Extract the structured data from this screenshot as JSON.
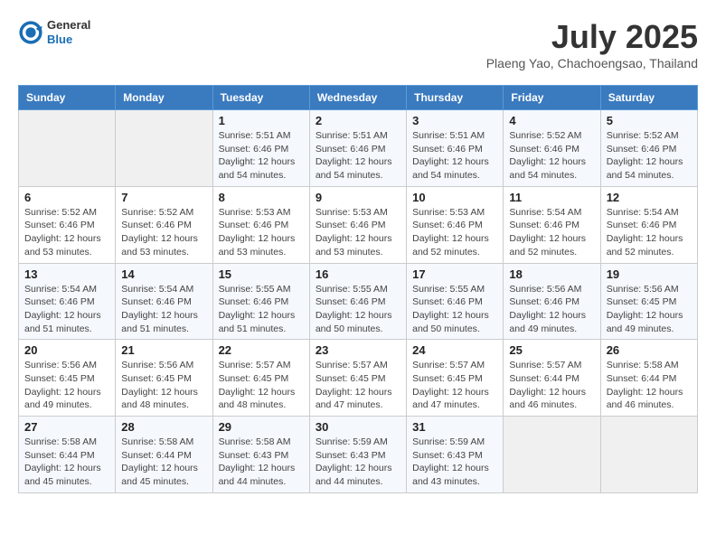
{
  "logo": {
    "general": "General",
    "blue": "Blue"
  },
  "title": "July 2025",
  "subtitle": "Plaeng Yao, Chachoengsao, Thailand",
  "days_of_week": [
    "Sunday",
    "Monday",
    "Tuesday",
    "Wednesday",
    "Thursday",
    "Friday",
    "Saturday"
  ],
  "weeks": [
    [
      {
        "day": "",
        "sunrise": "",
        "sunset": "",
        "daylight": ""
      },
      {
        "day": "",
        "sunrise": "",
        "sunset": "",
        "daylight": ""
      },
      {
        "day": "1",
        "sunrise": "Sunrise: 5:51 AM",
        "sunset": "Sunset: 6:46 PM",
        "daylight": "Daylight: 12 hours and 54 minutes."
      },
      {
        "day": "2",
        "sunrise": "Sunrise: 5:51 AM",
        "sunset": "Sunset: 6:46 PM",
        "daylight": "Daylight: 12 hours and 54 minutes."
      },
      {
        "day": "3",
        "sunrise": "Sunrise: 5:51 AM",
        "sunset": "Sunset: 6:46 PM",
        "daylight": "Daylight: 12 hours and 54 minutes."
      },
      {
        "day": "4",
        "sunrise": "Sunrise: 5:52 AM",
        "sunset": "Sunset: 6:46 PM",
        "daylight": "Daylight: 12 hours and 54 minutes."
      },
      {
        "day": "5",
        "sunrise": "Sunrise: 5:52 AM",
        "sunset": "Sunset: 6:46 PM",
        "daylight": "Daylight: 12 hours and 54 minutes."
      }
    ],
    [
      {
        "day": "6",
        "sunrise": "Sunrise: 5:52 AM",
        "sunset": "Sunset: 6:46 PM",
        "daylight": "Daylight: 12 hours and 53 minutes."
      },
      {
        "day": "7",
        "sunrise": "Sunrise: 5:52 AM",
        "sunset": "Sunset: 6:46 PM",
        "daylight": "Daylight: 12 hours and 53 minutes."
      },
      {
        "day": "8",
        "sunrise": "Sunrise: 5:53 AM",
        "sunset": "Sunset: 6:46 PM",
        "daylight": "Daylight: 12 hours and 53 minutes."
      },
      {
        "day": "9",
        "sunrise": "Sunrise: 5:53 AM",
        "sunset": "Sunset: 6:46 PM",
        "daylight": "Daylight: 12 hours and 53 minutes."
      },
      {
        "day": "10",
        "sunrise": "Sunrise: 5:53 AM",
        "sunset": "Sunset: 6:46 PM",
        "daylight": "Daylight: 12 hours and 52 minutes."
      },
      {
        "day": "11",
        "sunrise": "Sunrise: 5:54 AM",
        "sunset": "Sunset: 6:46 PM",
        "daylight": "Daylight: 12 hours and 52 minutes."
      },
      {
        "day": "12",
        "sunrise": "Sunrise: 5:54 AM",
        "sunset": "Sunset: 6:46 PM",
        "daylight": "Daylight: 12 hours and 52 minutes."
      }
    ],
    [
      {
        "day": "13",
        "sunrise": "Sunrise: 5:54 AM",
        "sunset": "Sunset: 6:46 PM",
        "daylight": "Daylight: 12 hours and 51 minutes."
      },
      {
        "day": "14",
        "sunrise": "Sunrise: 5:54 AM",
        "sunset": "Sunset: 6:46 PM",
        "daylight": "Daylight: 12 hours and 51 minutes."
      },
      {
        "day": "15",
        "sunrise": "Sunrise: 5:55 AM",
        "sunset": "Sunset: 6:46 PM",
        "daylight": "Daylight: 12 hours and 51 minutes."
      },
      {
        "day": "16",
        "sunrise": "Sunrise: 5:55 AM",
        "sunset": "Sunset: 6:46 PM",
        "daylight": "Daylight: 12 hours and 50 minutes."
      },
      {
        "day": "17",
        "sunrise": "Sunrise: 5:55 AM",
        "sunset": "Sunset: 6:46 PM",
        "daylight": "Daylight: 12 hours and 50 minutes."
      },
      {
        "day": "18",
        "sunrise": "Sunrise: 5:56 AM",
        "sunset": "Sunset: 6:46 PM",
        "daylight": "Daylight: 12 hours and 49 minutes."
      },
      {
        "day": "19",
        "sunrise": "Sunrise: 5:56 AM",
        "sunset": "Sunset: 6:45 PM",
        "daylight": "Daylight: 12 hours and 49 minutes."
      }
    ],
    [
      {
        "day": "20",
        "sunrise": "Sunrise: 5:56 AM",
        "sunset": "Sunset: 6:45 PM",
        "daylight": "Daylight: 12 hours and 49 minutes."
      },
      {
        "day": "21",
        "sunrise": "Sunrise: 5:56 AM",
        "sunset": "Sunset: 6:45 PM",
        "daylight": "Daylight: 12 hours and 48 minutes."
      },
      {
        "day": "22",
        "sunrise": "Sunrise: 5:57 AM",
        "sunset": "Sunset: 6:45 PM",
        "daylight": "Daylight: 12 hours and 48 minutes."
      },
      {
        "day": "23",
        "sunrise": "Sunrise: 5:57 AM",
        "sunset": "Sunset: 6:45 PM",
        "daylight": "Daylight: 12 hours and 47 minutes."
      },
      {
        "day": "24",
        "sunrise": "Sunrise: 5:57 AM",
        "sunset": "Sunset: 6:45 PM",
        "daylight": "Daylight: 12 hours and 47 minutes."
      },
      {
        "day": "25",
        "sunrise": "Sunrise: 5:57 AM",
        "sunset": "Sunset: 6:44 PM",
        "daylight": "Daylight: 12 hours and 46 minutes."
      },
      {
        "day": "26",
        "sunrise": "Sunrise: 5:58 AM",
        "sunset": "Sunset: 6:44 PM",
        "daylight": "Daylight: 12 hours and 46 minutes."
      }
    ],
    [
      {
        "day": "27",
        "sunrise": "Sunrise: 5:58 AM",
        "sunset": "Sunset: 6:44 PM",
        "daylight": "Daylight: 12 hours and 45 minutes."
      },
      {
        "day": "28",
        "sunrise": "Sunrise: 5:58 AM",
        "sunset": "Sunset: 6:44 PM",
        "daylight": "Daylight: 12 hours and 45 minutes."
      },
      {
        "day": "29",
        "sunrise": "Sunrise: 5:58 AM",
        "sunset": "Sunset: 6:43 PM",
        "daylight": "Daylight: 12 hours and 44 minutes."
      },
      {
        "day": "30",
        "sunrise": "Sunrise: 5:59 AM",
        "sunset": "Sunset: 6:43 PM",
        "daylight": "Daylight: 12 hours and 44 minutes."
      },
      {
        "day": "31",
        "sunrise": "Sunrise: 5:59 AM",
        "sunset": "Sunset: 6:43 PM",
        "daylight": "Daylight: 12 hours and 43 minutes."
      },
      {
        "day": "",
        "sunrise": "",
        "sunset": "",
        "daylight": ""
      },
      {
        "day": "",
        "sunrise": "",
        "sunset": "",
        "daylight": ""
      }
    ]
  ]
}
